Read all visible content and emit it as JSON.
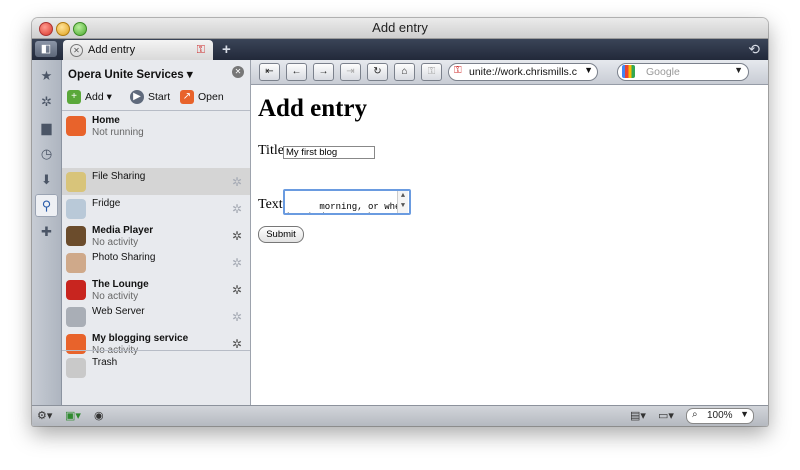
{
  "window": {
    "title": "Add entry"
  },
  "tab": {
    "label": "Add entry"
  },
  "panel": {
    "title": "Opera Unite Services",
    "tools": {
      "add": "Add",
      "start": "Start",
      "open": "Open"
    },
    "services": [
      {
        "name": "Home",
        "status": "Not running",
        "bold": true,
        "icon_color": "#e8632b"
      },
      {
        "name": "File Sharing",
        "status": "",
        "bold": false,
        "icon_color": "#d8c47a"
      },
      {
        "name": "Fridge",
        "status": "",
        "bold": false,
        "icon_color": "#b9c9d8"
      },
      {
        "name": "Media Player",
        "status": "No activity",
        "bold": true,
        "icon_color": "#6b4c2c"
      },
      {
        "name": "Photo Sharing",
        "status": "",
        "bold": false,
        "icon_color": "#cfa98a"
      },
      {
        "name": "The Lounge",
        "status": "No activity",
        "bold": true,
        "icon_color": "#c8251f"
      },
      {
        "name": "Web Server",
        "status": "",
        "bold": false,
        "icon_color": "#a9aeb6"
      },
      {
        "name": "My blogging service",
        "status": "No activity",
        "bold": true,
        "icon_color": "#e8632b"
      }
    ],
    "trash": "Trash"
  },
  "address": {
    "url": "unite://work.chrismills.c"
  },
  "search": {
    "placeholder": "Google"
  },
  "page": {
    "heading": "Add entry",
    "title_label": "Title",
    "title_value": "My first blog",
    "text_label": "Text",
    "text_value": "morning, or when I\nbrushed my teeth!",
    "submit": "Submit"
  },
  "status": {
    "zoom": "100%"
  }
}
